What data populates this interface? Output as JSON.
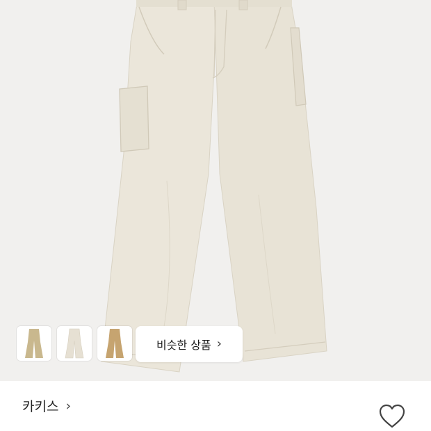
{
  "product": {
    "image_icon": "cargo-pants-image",
    "main_color": "#ebe6da"
  },
  "thumbnails": [
    {
      "icon": "pants-thumbnail",
      "color": "#c9b88e"
    },
    {
      "icon": "pants-thumbnail",
      "color": "#e6e0d3"
    },
    {
      "icon": "pants-thumbnail",
      "color": "#c6a470"
    }
  ],
  "similar_button": {
    "label": "비슷한 상품",
    "chevron": "›"
  },
  "color_selector": {
    "label": "카키스",
    "chevron": "›"
  },
  "wishlist": {
    "icon": "heart-outline-icon"
  }
}
